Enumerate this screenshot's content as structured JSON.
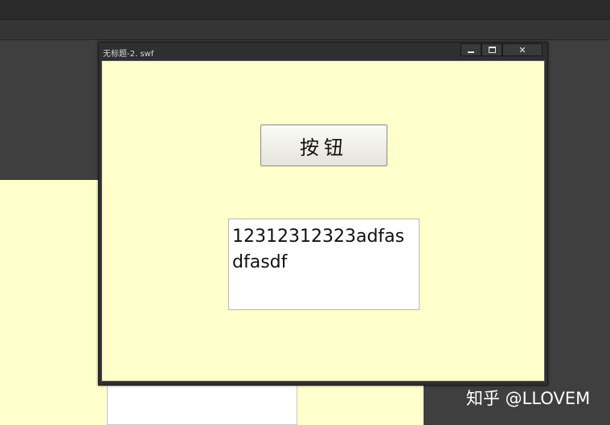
{
  "window": {
    "title": "无标题-2. swf",
    "minimize_icon": "minimize-icon",
    "maximize_icon": "maximize-icon",
    "close_icon": "close-icon",
    "close_glyph": "✕"
  },
  "stage": {
    "button_label": "按钮",
    "textarea_value": "12312312323adfasdfasdf"
  },
  "watermark": "知乎 @LLOVEM",
  "colors": {
    "stage_bg": "#ffffcc",
    "workspace_bg": "#3f3f3f",
    "window_chrome": "#2f2f2f"
  }
}
